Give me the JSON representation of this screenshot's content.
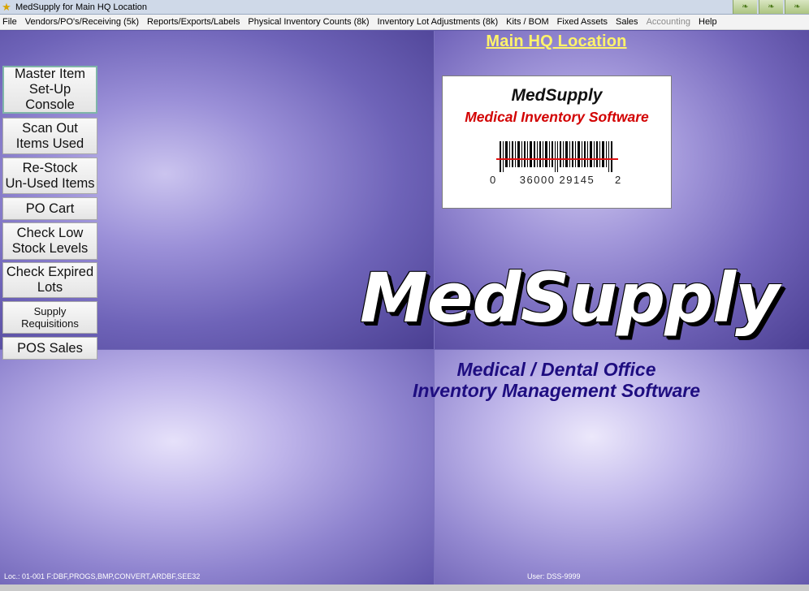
{
  "window": {
    "title": "MedSupply for Main HQ Location",
    "app_icon": "star-icon",
    "taskbar_tile_icon": "leaf-icon"
  },
  "menu": [
    {
      "label": "File"
    },
    {
      "label": "Vendors/PO's/Receiving (5k)"
    },
    {
      "label": "Reports/Exports/Labels"
    },
    {
      "label": "Physical Inventory Counts (8k)"
    },
    {
      "label": "Inventory Lot Adjustments (8k)"
    },
    {
      "label": "Kits / BOM"
    },
    {
      "label": "Fixed Assets"
    },
    {
      "label": "Sales"
    },
    {
      "label": "Accounting",
      "disabled": true
    },
    {
      "label": "Help"
    }
  ],
  "sidebar": {
    "buttons": [
      {
        "label": "Master Item\nSet-Up\nConsole"
      },
      {
        "label": "Scan Out\nItems Used"
      },
      {
        "label": "Re-Stock\nUn-Used Items"
      },
      {
        "label": "PO Cart"
      },
      {
        "label": "Check Low\nStock Levels"
      },
      {
        "label": "Check Expired\nLots"
      },
      {
        "label": "Supply\nRequisitions"
      },
      {
        "label": "POS Sales"
      }
    ]
  },
  "location_title": "Main HQ Location",
  "logo_box": {
    "brand": "MedSupply",
    "subtitle": "Medical Inventory Software",
    "barcode_left": "0",
    "barcode_middle": "36000 29145",
    "barcode_right": "2"
  },
  "big_logo": "MedSupply",
  "tagline_1": "Medical / Dental Office",
  "tagline_2": "Inventory Management Software",
  "status": {
    "location": "Loc.: 01-001   F:DBF,PROGS,BMP,CONVERT,ARDBF,SEE32",
    "user": "User: DSS-9999"
  },
  "colors": {
    "location_title": "#fff36a",
    "tagline": "#1e0d80",
    "logo_subtitle": "#d20000",
    "background_accent": "#6e63b8"
  }
}
